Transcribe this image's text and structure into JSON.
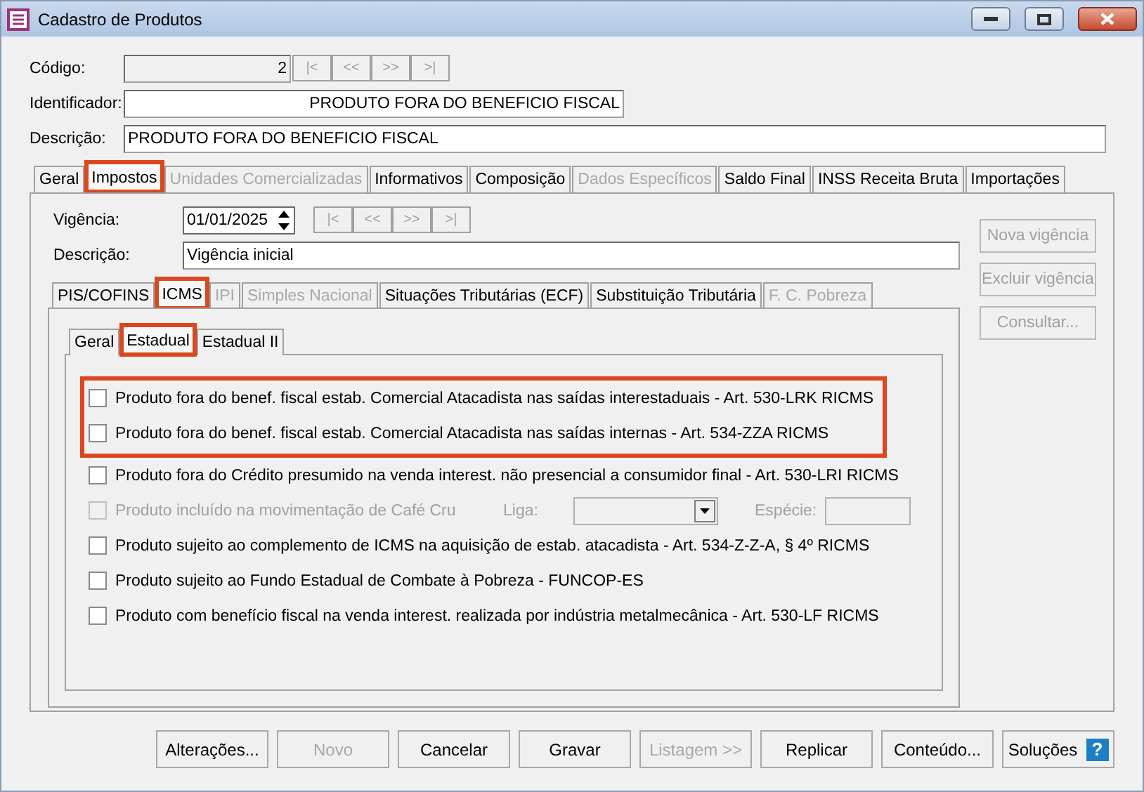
{
  "window": {
    "title": "Cadastro de Produtos"
  },
  "fields": [
    {
      "kind": "code",
      "label": "Código:",
      "value": "2"
    },
    {
      "kind": "right",
      "label": "Identificador:",
      "value": "PRODUTO FORA DO BENEFICIO FISCAL"
    },
    {
      "kind": "wide",
      "label": "Descrição:",
      "value": "PRODUTO FORA DO BENEFICIO FISCAL"
    }
  ],
  "nav_buttons": [
    "|<",
    "<<",
    ">>",
    ">|"
  ],
  "tabs": [
    {
      "label": "Geral",
      "selected": false,
      "disabled": false,
      "highlighted": false
    },
    {
      "label": "Impostos",
      "selected": true,
      "disabled": false,
      "highlighted": true
    },
    {
      "label": "Unidades Comercializadas",
      "selected": false,
      "disabled": true,
      "highlighted": false
    },
    {
      "label": "Informativos",
      "selected": false,
      "disabled": false,
      "highlighted": false
    },
    {
      "label": "Composição",
      "selected": false,
      "disabled": false,
      "highlighted": false
    },
    {
      "label": "Dados Específicos",
      "selected": false,
      "disabled": true,
      "highlighted": false
    },
    {
      "label": "Saldo Final",
      "selected": false,
      "disabled": false,
      "highlighted": false
    },
    {
      "label": "INSS Receita Bruta",
      "selected": false,
      "disabled": false,
      "highlighted": false
    },
    {
      "label": "Importações",
      "selected": false,
      "disabled": false,
      "highlighted": false
    }
  ],
  "vigencia": {
    "label": "Vigência:",
    "value": "01/01/2025"
  },
  "vigencia_nav": [
    "|<",
    "<<",
    ">>",
    ">|"
  ],
  "vigencia_description": {
    "label": "Descrição:",
    "value": "Vigência inicial"
  },
  "side_buttons": [
    {
      "label": "Nova vigência",
      "disabled": true
    },
    {
      "label": "Excluir vigência",
      "disabled": true
    },
    {
      "label": "Consultar...",
      "disabled": true
    }
  ],
  "tax_tabs": [
    {
      "label": "PIS/COFINS",
      "selected": false,
      "disabled": false,
      "highlighted": false
    },
    {
      "label": "ICMS",
      "selected": true,
      "disabled": false,
      "highlighted": true
    },
    {
      "label": "IPI",
      "selected": false,
      "disabled": true,
      "highlighted": false
    },
    {
      "label": "Simples Nacional",
      "selected": false,
      "disabled": true,
      "highlighted": false
    },
    {
      "label": "Situações Tributárias (ECF)",
      "selected": false,
      "disabled": false,
      "highlighted": false
    },
    {
      "label": "Substituição Tributária",
      "selected": false,
      "disabled": false,
      "highlighted": false
    },
    {
      "label": "F. C. Pobreza",
      "selected": false,
      "disabled": true,
      "highlighted": false
    }
  ],
  "sub_tabs": [
    {
      "label": "Geral",
      "selected": false,
      "disabled": false,
      "highlighted": false
    },
    {
      "label": "Estadual",
      "selected": true,
      "disabled": false,
      "highlighted": true
    },
    {
      "label": "Estadual II",
      "selected": false,
      "disabled": false,
      "highlighted": false
    }
  ],
  "options": [
    {
      "kind": "checkbox",
      "label": "Produto fora do benef. fiscal estab. Comercial Atacadista nas saídas interestaduais - Art. 530-LRK RICMS",
      "checked": false,
      "disabled": false,
      "highlighted": true
    },
    {
      "kind": "checkbox",
      "label": "Produto fora do benef. fiscal estab. Comercial Atacadista nas saídas internas - Art. 534-ZZA RICMS",
      "checked": false,
      "disabled": false,
      "highlighted": true
    },
    {
      "kind": "checkbox",
      "label": "Produto fora do Crédito presumido na venda interest. não presencial a consumidor final - Art. 530-LRI RICMS",
      "checked": false,
      "disabled": false,
      "highlighted": false
    },
    {
      "kind": "checkbox_fields",
      "label": "Produto incluído na movimentação de Café Cru",
      "checked": false,
      "disabled": true,
      "highlighted": false,
      "liga_label": "Liga:",
      "especie_label": "Espécie:"
    },
    {
      "kind": "checkbox",
      "label": "Produto sujeito ao complemento de ICMS na aquisição de estab. atacadista - Art. 534-Z-Z-A, § 4º RICMS",
      "checked": false,
      "disabled": false,
      "highlighted": false
    },
    {
      "kind": "checkbox",
      "label": "Produto sujeito ao Fundo Estadual de Combate à Pobreza - FUNCOP-ES",
      "checked": false,
      "disabled": false,
      "highlighted": false
    },
    {
      "kind": "checkbox",
      "label": "Produto com benefício fiscal na venda interest. realizada por indústria metalmecânica - Art. 530-LF RICMS",
      "checked": false,
      "disabled": false,
      "highlighted": false
    }
  ],
  "buttons": [
    {
      "label": "Alterações...",
      "disabled": false
    },
    {
      "label": "Novo",
      "disabled": true
    },
    {
      "label": "Cancelar",
      "disabled": false
    },
    {
      "label": "Gravar",
      "disabled": false
    },
    {
      "label": "Listagem >>",
      "disabled": true
    },
    {
      "label": "Replicar",
      "disabled": false
    },
    {
      "label": "Conteúdo...",
      "disabled": false
    }
  ],
  "help_button": {
    "label": "Soluções",
    "badge": "?"
  }
}
